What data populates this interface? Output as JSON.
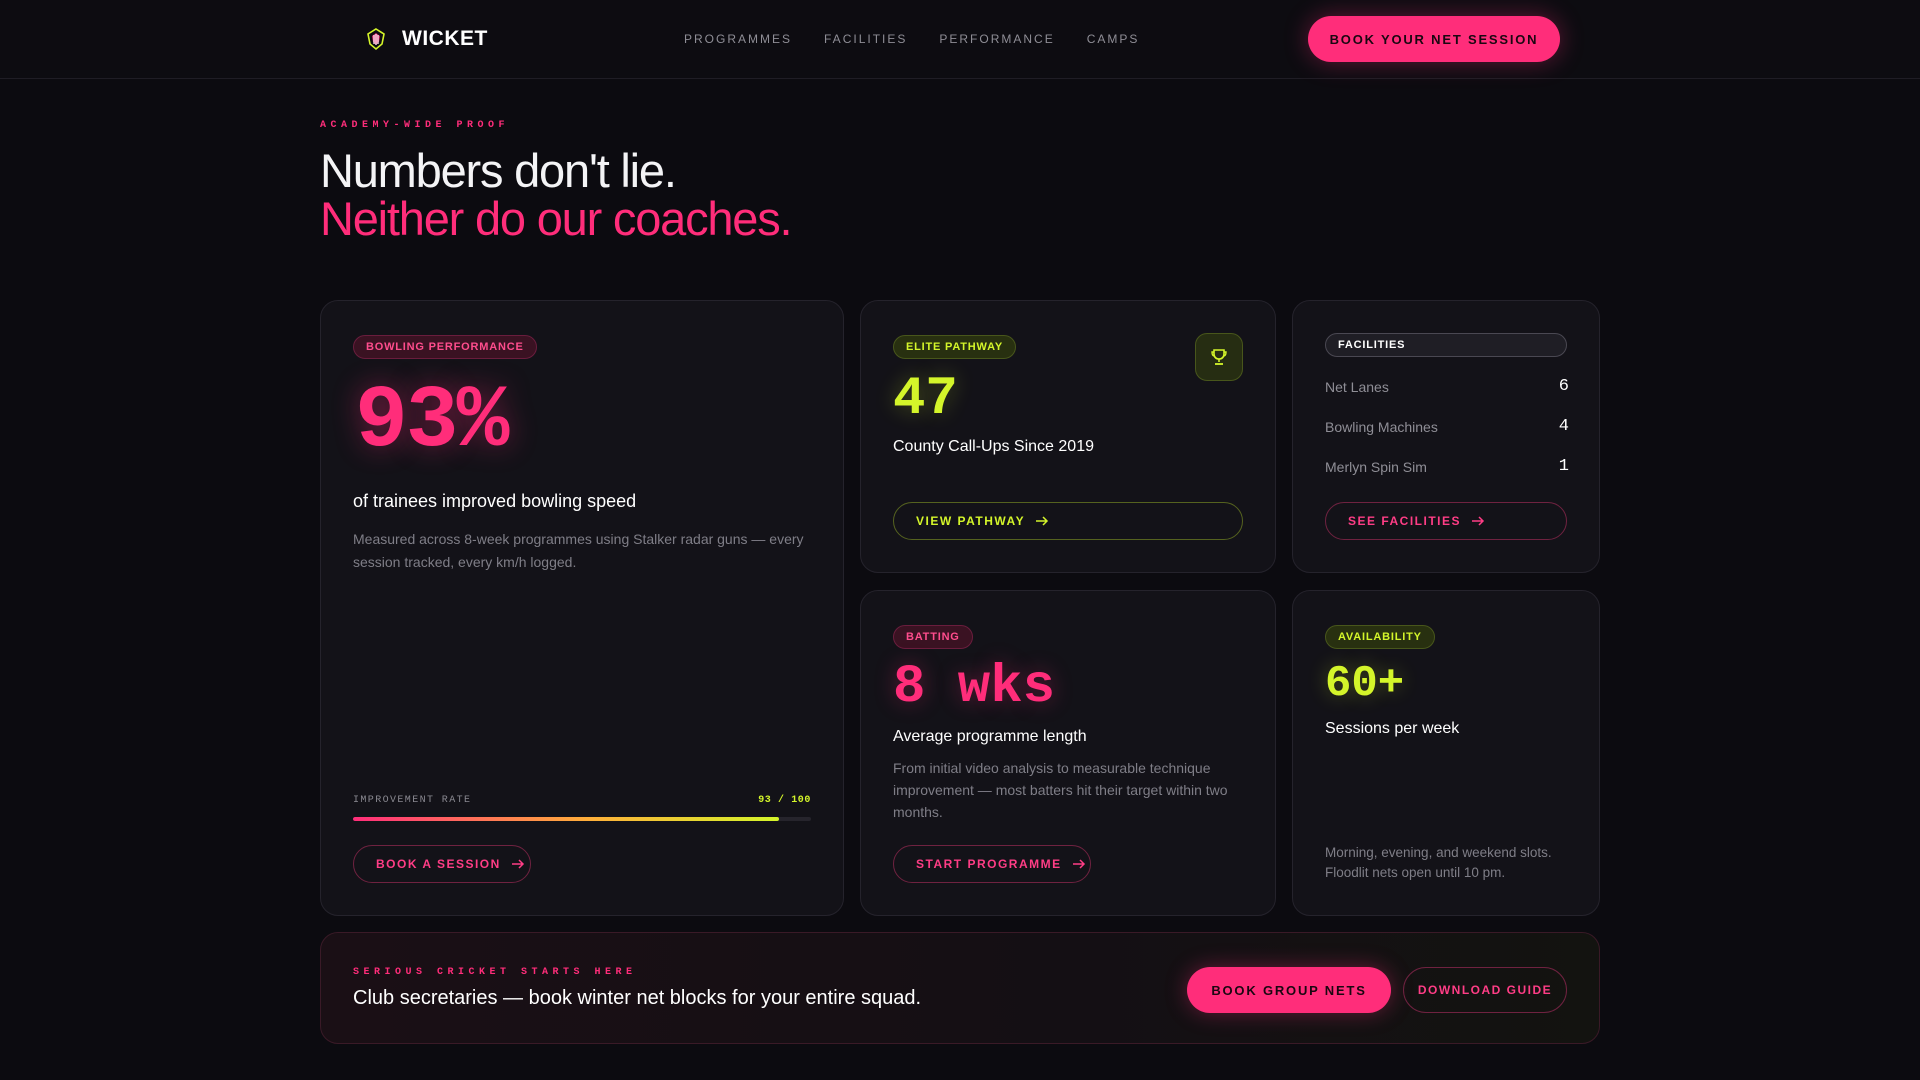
{
  "nav": {
    "brand": "WICKET",
    "links": [
      "PROGRAMMES",
      "FACILITIES",
      "PERFORMANCE",
      "CAMPS"
    ],
    "cta": "BOOK YOUR NET SESSION"
  },
  "hero": {
    "eyebrow": "ACADEMY-WIDE PROOF",
    "title": "Numbers don't lie.",
    "title_accent": "Neither do our coaches."
  },
  "bowling": {
    "tag": "BOWLING PERFORMANCE",
    "stat": "93%",
    "subtitle": "of trainees improved bowling speed",
    "description": "Measured across 8-week programmes using Stalker radar guns — every session tracked, every km/h logged.",
    "rate_label": "IMPROVEMENT RATE",
    "rate_text": "93 / 100",
    "rate_fraction": 0.93,
    "button": "BOOK A SESSION"
  },
  "pathway": {
    "tag": "ELITE PATHWAY",
    "icon": "trophy-icon",
    "stat": "47",
    "subtitle": "County Call-Ups Since 2019",
    "button": "VIEW PATHWAY"
  },
  "facilities": {
    "tag": "FACILITIES",
    "rows": [
      {
        "label": "Net Lanes",
        "value": "6"
      },
      {
        "label": "Bowling Machines",
        "value": "4"
      },
      {
        "label": "Merlyn Spin Sim",
        "value": "1"
      }
    ],
    "button": "SEE FACILITIES"
  },
  "batting": {
    "tag": "BATTING",
    "stat": "8 wks",
    "subtitle": "Average programme length",
    "description": "From initial video analysis to measurable technique improvement — most batters hit their target within two months.",
    "button": "START PROGRAMME"
  },
  "availability": {
    "tag": "AVAILABILITY",
    "stat": "60+",
    "subtitle": "Sessions per week",
    "description": "Morning, evening, and weekend slots. Floodlit nets open until 10 pm."
  },
  "strip": {
    "eyebrow": "SERIOUS CRICKET STARTS HERE",
    "text": "Club secretaries — book winter net blocks for your entire squad.",
    "primary_button": "BOOK GROUP NETS",
    "secondary_button": "DOWNLOAD GUIDE"
  },
  "colors": {
    "accent_pink": "#ff2d7a",
    "accent_lime": "#d4f52a",
    "background": "#0c0b10",
    "card": "#131218"
  }
}
